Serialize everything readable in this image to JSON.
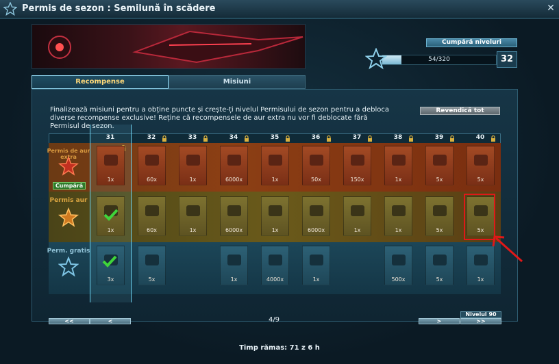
{
  "window": {
    "title": "Permis de sezon : Semilună în scădere",
    "close_label": "✕"
  },
  "header": {
    "buy_levels_label": "Cumpără niveluri",
    "xp_text": "54/320",
    "xp_progress": 0.17,
    "current_level": "32"
  },
  "tabs": [
    {
      "label": "Recompense",
      "active": true
    },
    {
      "label": "Misiuni",
      "active": false
    }
  ],
  "description": "Finalizează misiuni pentru a obține puncte și crește-ți nivelul Permisului de sezon pentru a debloca diverse recompense exclusive! Reține că recompensele de aur extra nu vor fi deblocate fără Permisul de sezon.",
  "claim_all_label": "Revendică tot",
  "tiers": {
    "gold_extra_label": "Permis de aur extra",
    "buy_label": "Cumpără",
    "gold_label": "Permis aur",
    "free_label": "Perm. gratis"
  },
  "columns": [
    "31",
    "32",
    "33",
    "34",
    "35",
    "36",
    "37",
    "38",
    "39",
    "40"
  ],
  "rows": {
    "gold_extra": [
      "1x",
      "60x",
      "1x",
      "6000x",
      "1x",
      "50x",
      "150x",
      "1x",
      "5x",
      "5x"
    ],
    "gold": [
      "1x",
      "60x",
      "1x",
      "6000x",
      "1x",
      "6000x",
      "1x",
      "1x",
      "5x",
      "5x"
    ],
    "free": [
      "3x",
      "5x",
      "",
      "1x",
      "4000x",
      "1x",
      "",
      "500x",
      "5x",
      "1x"
    ]
  },
  "navigation": {
    "first": "<<",
    "prev": "<",
    "page": "4/9",
    "next": ">",
    "last": ">>",
    "level_tag": "Nivelul 90"
  },
  "footer": {
    "time_left": "Timp rămas: 71 z 6 h"
  },
  "colors": {
    "accent": "#6fd7f5",
    "gold_extra": "#8c3f14",
    "gold": "#6a5a1a",
    "free": "#1c4658",
    "highlight": "#e01818"
  }
}
